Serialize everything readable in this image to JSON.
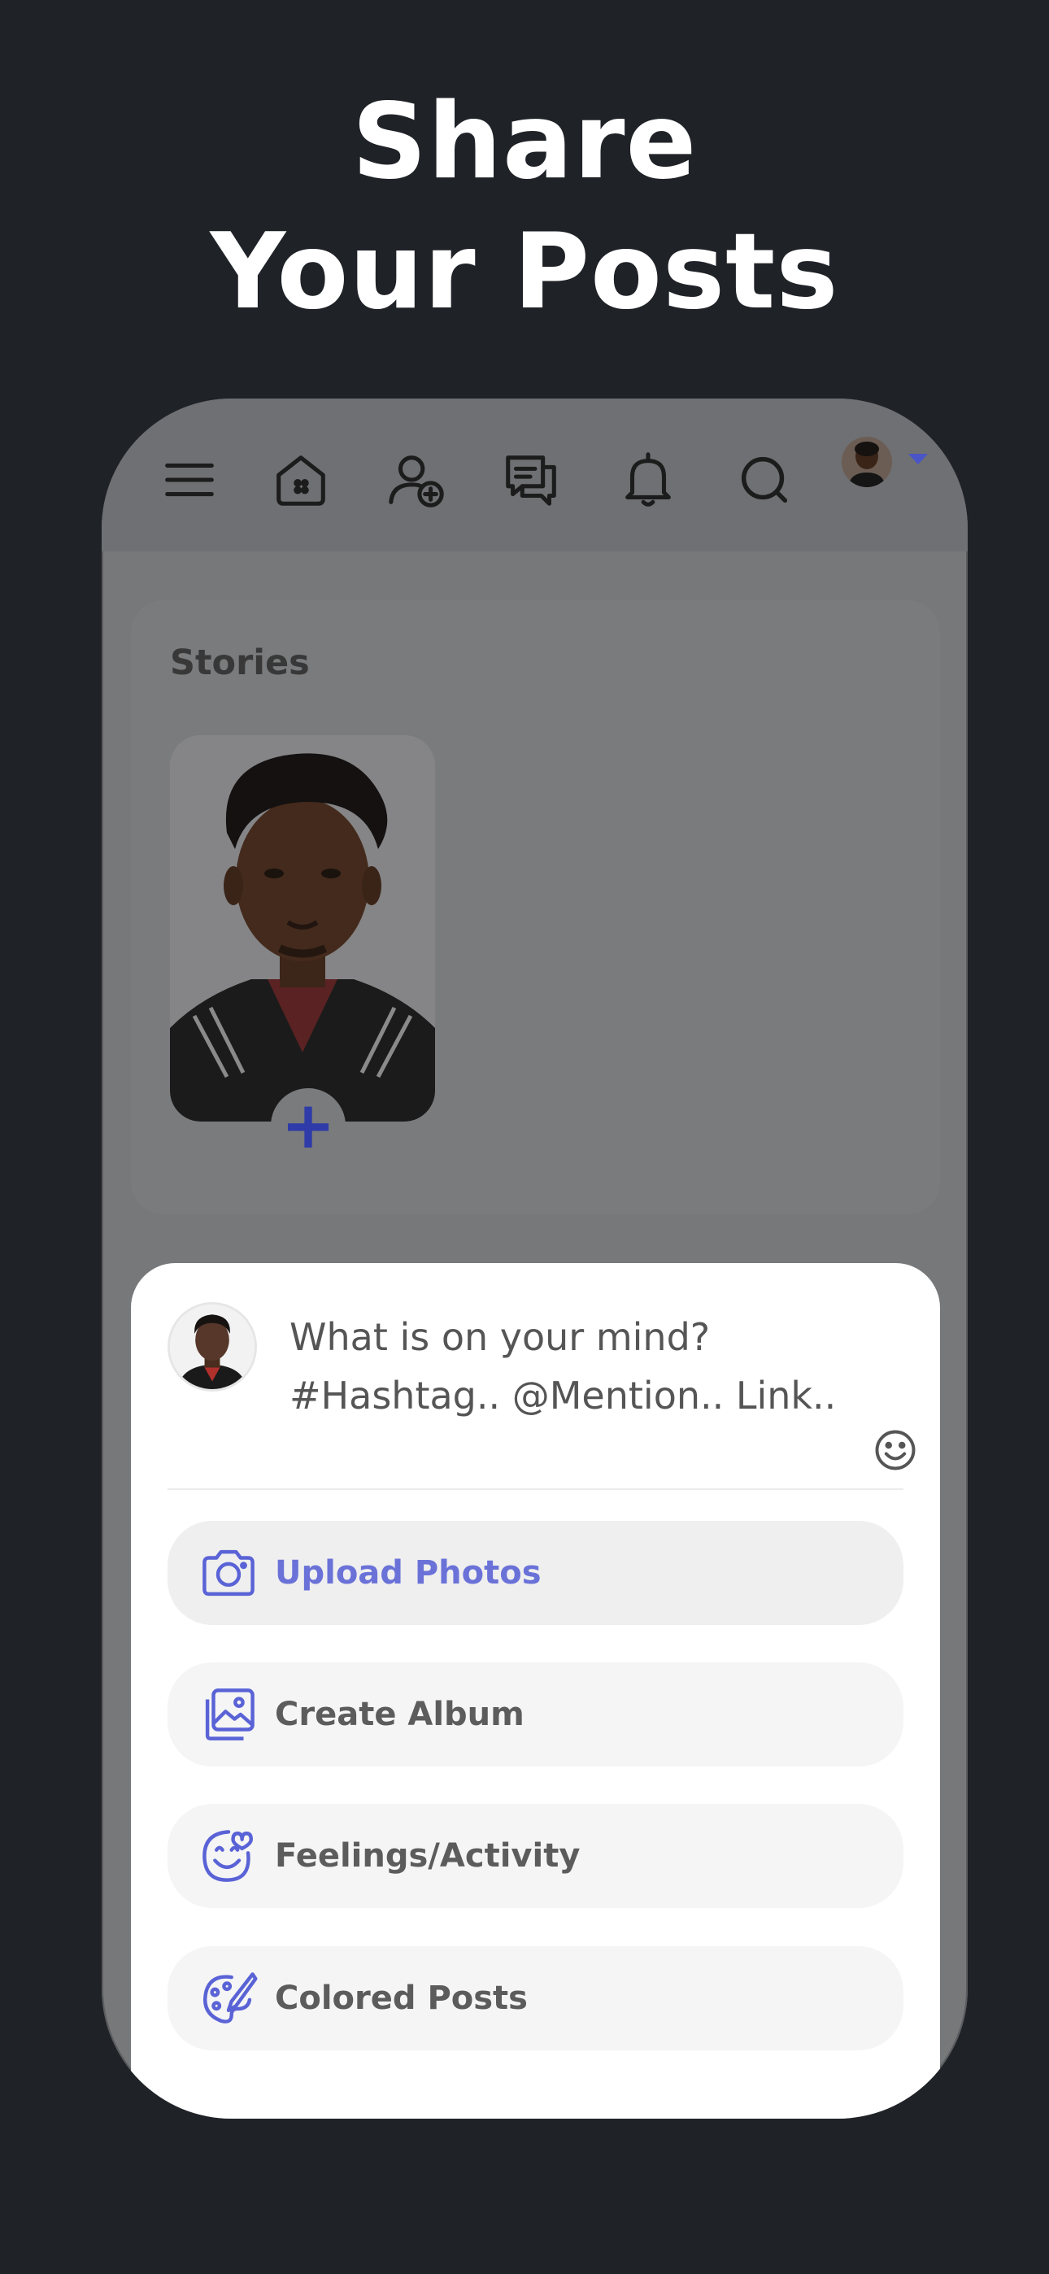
{
  "headline": {
    "line1": "Share",
    "line2": "Your Posts"
  },
  "nav": {
    "icons": [
      "menu-icon",
      "home-icon",
      "add-friend-icon",
      "messages-icon",
      "notifications-icon",
      "search-icon",
      "profile-avatar"
    ]
  },
  "stories": {
    "title": "Stories",
    "add_label": "+"
  },
  "composer": {
    "placeholder_line1": "What is on your mind?",
    "placeholder_line2": "#Hashtag.. @Mention.. Link.."
  },
  "actions": [
    {
      "label": "Upload Photos",
      "icon": "camera-icon"
    },
    {
      "label": "Create Album",
      "icon": "album-icon"
    },
    {
      "label": "Feelings/Activity",
      "icon": "feelings-icon"
    },
    {
      "label": "Colored Posts",
      "icon": "palette-icon"
    }
  ],
  "colors": {
    "accent": "#5a63d6",
    "background": "#1f2227",
    "brand_blue": "#2e3ba8"
  }
}
